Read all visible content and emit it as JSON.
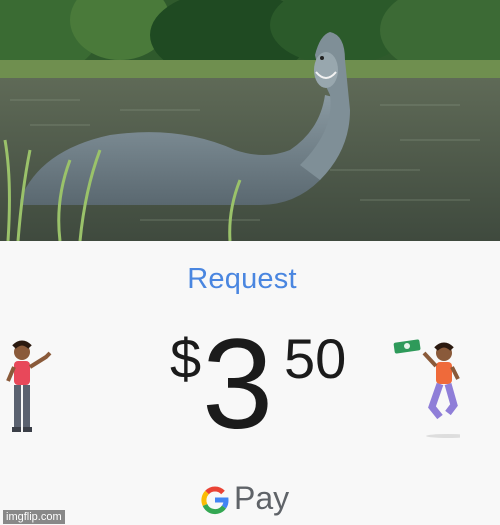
{
  "photo": {
    "subject": "lake-monster-photo"
  },
  "request": {
    "title": "Request",
    "currency_symbol": "$",
    "amount_whole": "3",
    "amount_cents": "50"
  },
  "branding": {
    "pay_label": "Pay",
    "google_colors": {
      "blue": "#4285F4",
      "red": "#EA4335",
      "yellow": "#FBBC05",
      "green": "#34A853"
    },
    "accent_color": "#4a86e0"
  },
  "watermark": {
    "text": "imgflip.com"
  }
}
